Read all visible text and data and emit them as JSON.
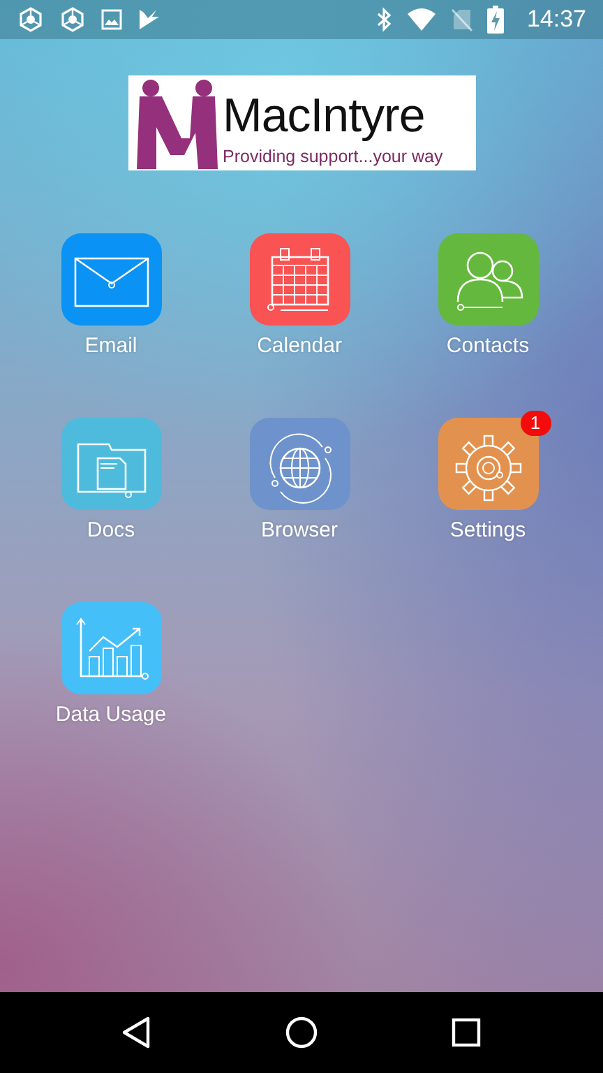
{
  "status_bar": {
    "time": "14:37"
  },
  "logo": {
    "name": "MacIntyre",
    "tagline": "Providing support...your way"
  },
  "apps": [
    {
      "label": "Email",
      "kind": "email",
      "color": "#0a92f5"
    },
    {
      "label": "Calendar",
      "kind": "calendar",
      "color": "#f95353"
    },
    {
      "label": "Contacts",
      "kind": "contacts",
      "color": "#65b83e"
    },
    {
      "label": "Docs",
      "kind": "docs",
      "color": "#4ebbdc"
    },
    {
      "label": "Browser",
      "kind": "browser",
      "color": "#6e93cc"
    },
    {
      "label": "Settings",
      "kind": "settings",
      "color": "#e2924e",
      "badge": "1"
    },
    {
      "label": "Data Usage",
      "kind": "data",
      "color": "#45bff8"
    }
  ]
}
